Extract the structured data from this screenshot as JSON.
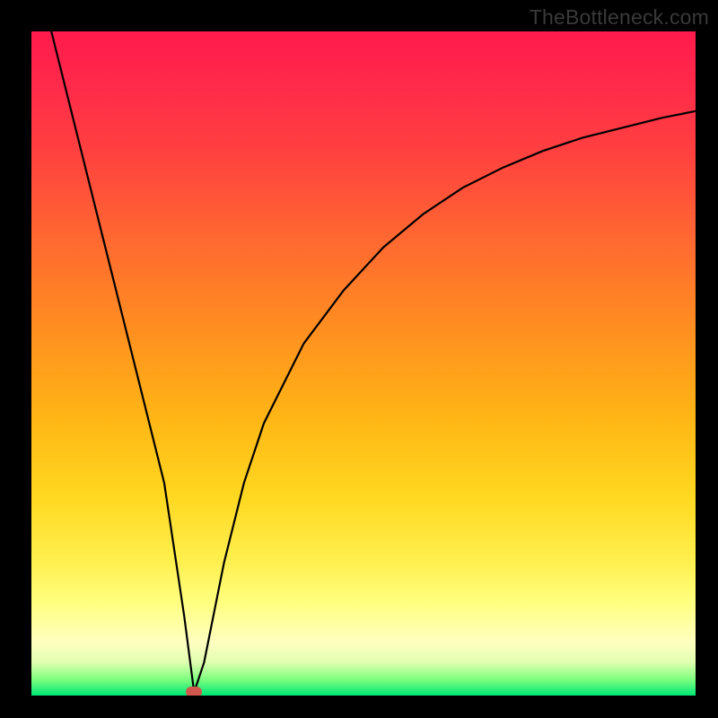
{
  "watermark": "TheBottleneck.com",
  "chart_data": {
    "type": "line",
    "title": "",
    "xlabel": "",
    "ylabel": "",
    "xlim": [
      0,
      100
    ],
    "ylim": [
      0,
      100
    ],
    "x": [
      3,
      5,
      8,
      11,
      14,
      17,
      20,
      23,
      24.5,
      26,
      29,
      32,
      35,
      41,
      47,
      53,
      59,
      65,
      71,
      77,
      83,
      89,
      95,
      100
    ],
    "y": [
      100,
      92,
      80,
      68,
      56,
      44,
      32,
      12,
      0.5,
      5,
      20,
      32,
      41,
      53,
      61,
      67.5,
      72.5,
      76.5,
      79.5,
      82,
      84,
      85.5,
      87,
      88
    ],
    "marker": {
      "x": 24.5,
      "y": 0.5
    },
    "gradient_stops": [
      {
        "pos": 0,
        "color": "#ff1a4d"
      },
      {
        "pos": 50,
        "color": "#ffb515"
      },
      {
        "pos": 86,
        "color": "#ffff80"
      },
      {
        "pos": 100,
        "color": "#00e676"
      }
    ]
  }
}
